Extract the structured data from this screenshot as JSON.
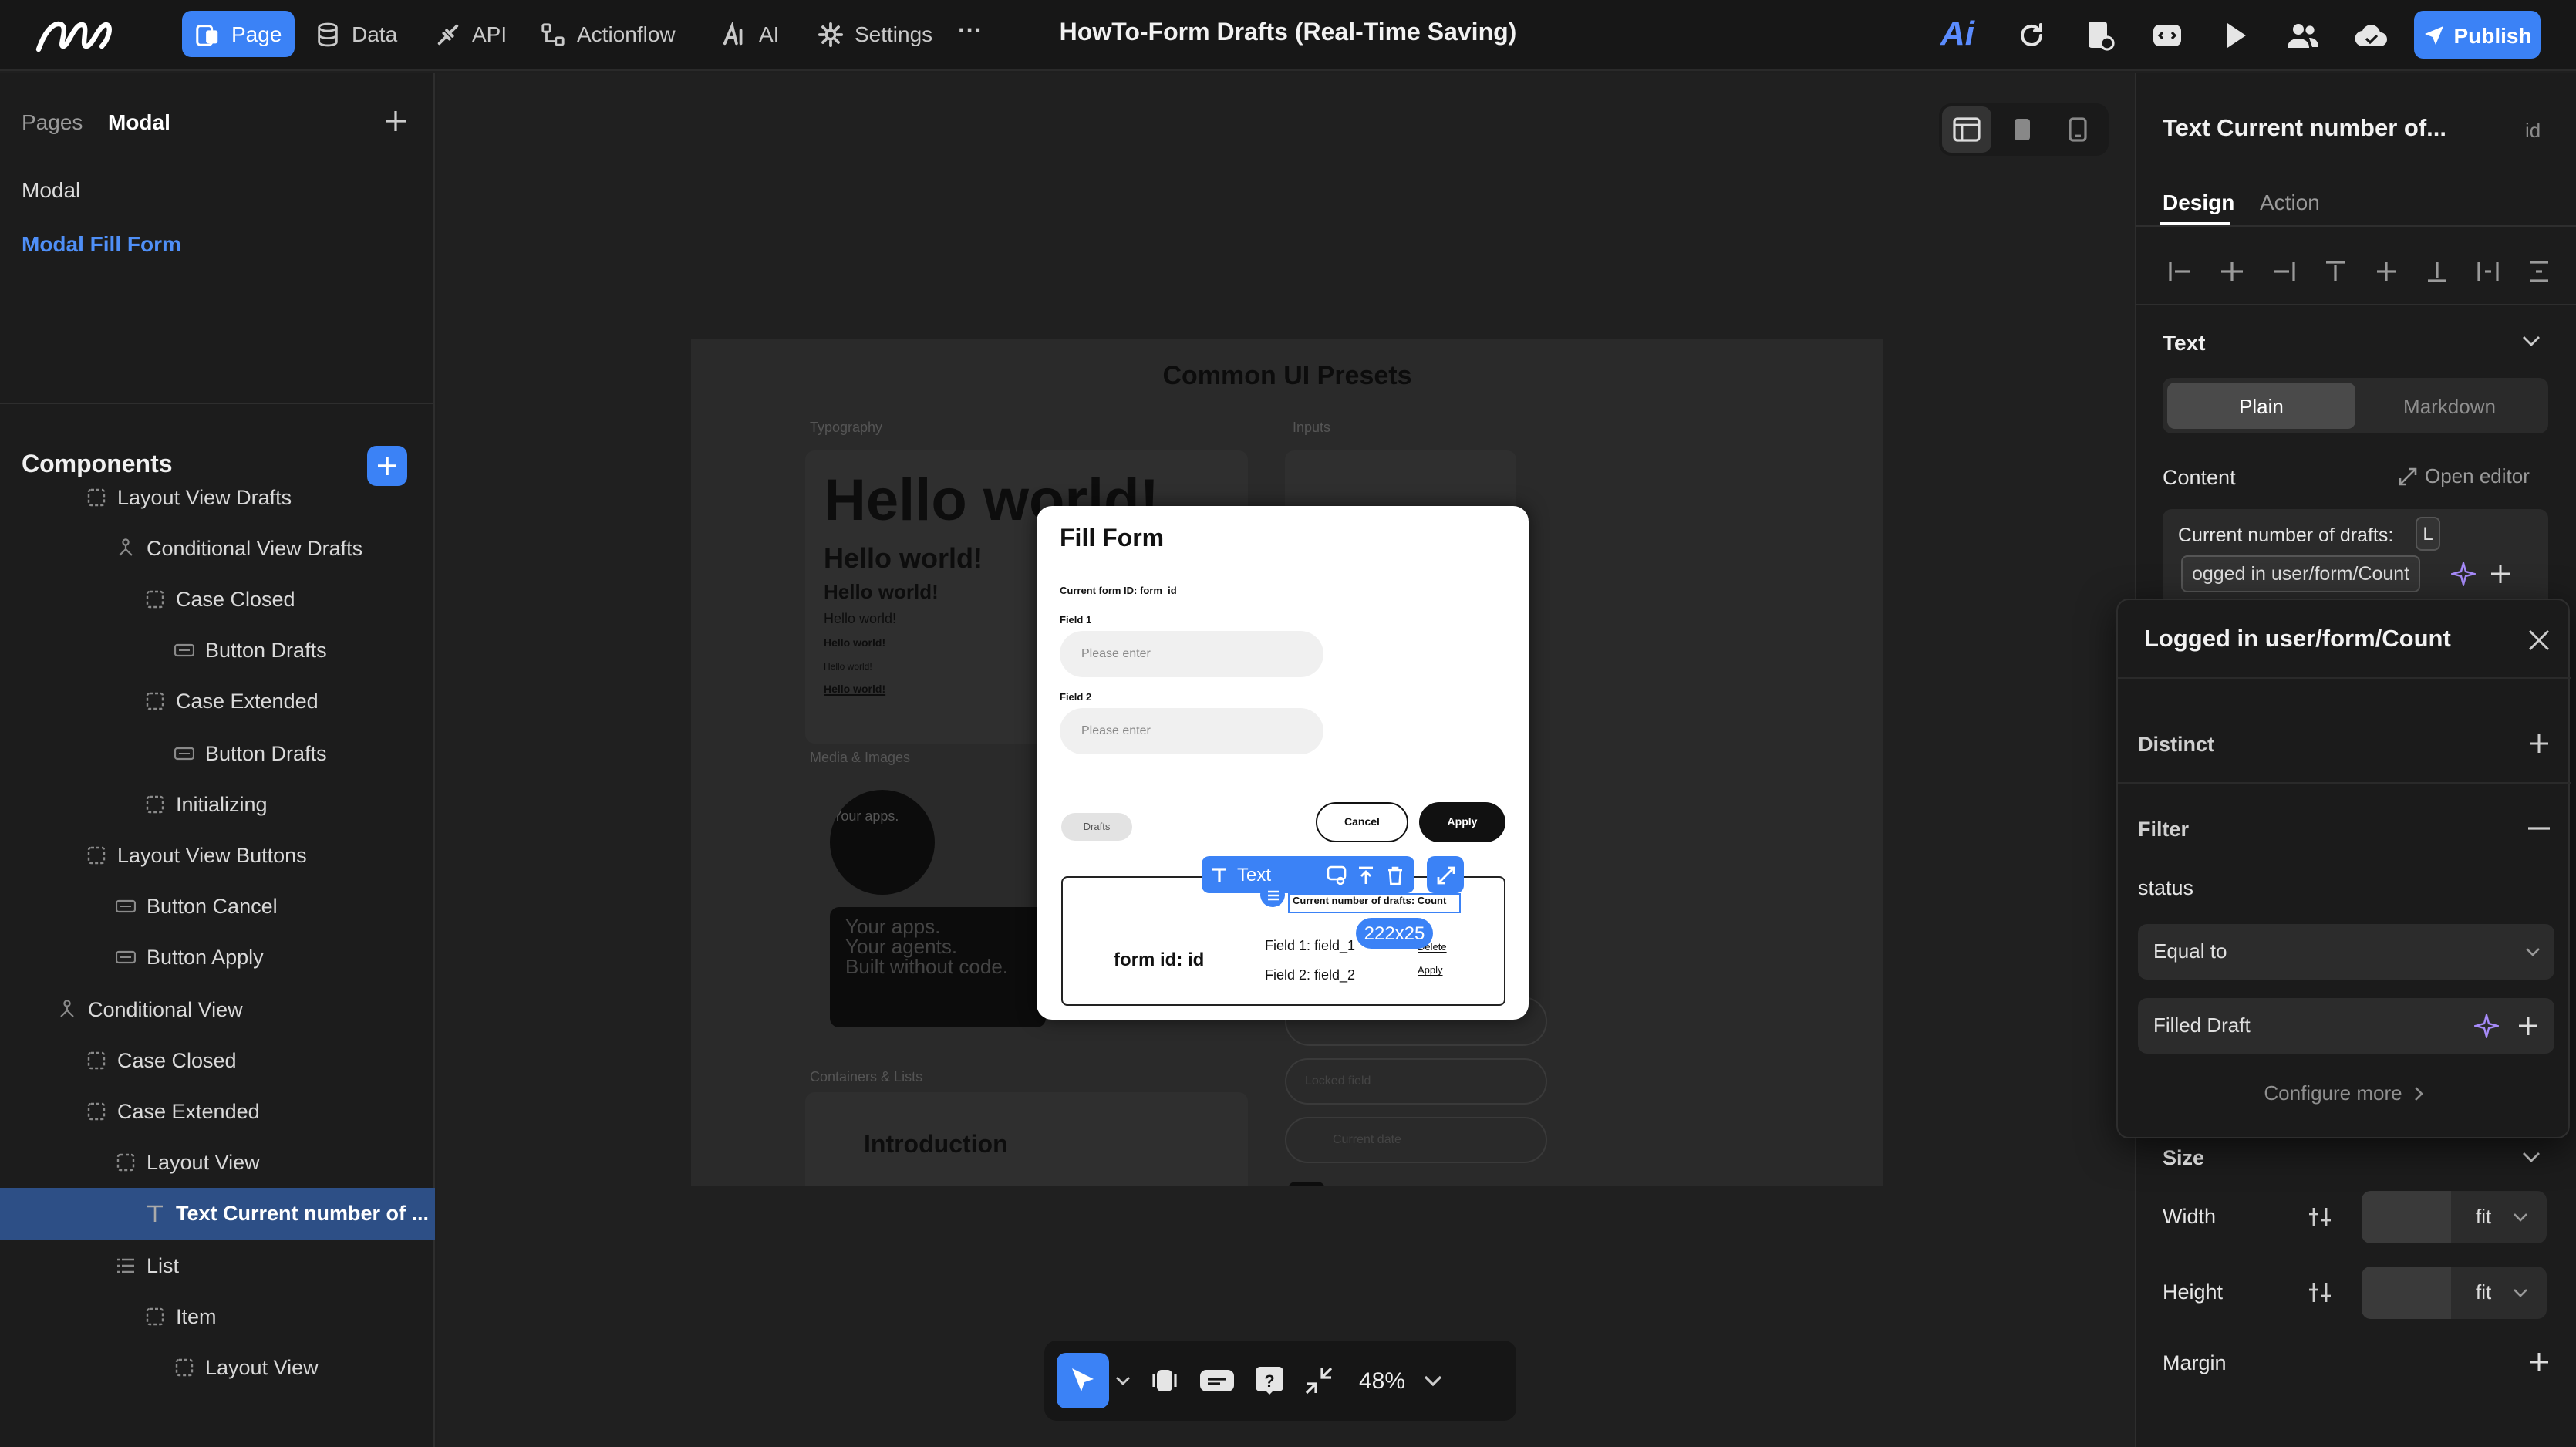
{
  "topbar": {
    "nav": [
      {
        "label": "Page",
        "icon": "page-icon"
      },
      {
        "label": "Data",
        "icon": "database-icon"
      },
      {
        "label": "API",
        "icon": "api-icon"
      },
      {
        "label": "Actionflow",
        "icon": "flow-icon"
      },
      {
        "label": "AI",
        "icon": "ai-icon"
      },
      {
        "label": "Settings",
        "icon": "gear-icon"
      }
    ],
    "more": "···",
    "project_title": "HowTo-Form Drafts (Real-Time Saving)",
    "publish": "Publish",
    "brand_ai": "Ai"
  },
  "left": {
    "tabs": [
      "Pages",
      "Modal"
    ],
    "pages": [
      "Modal",
      "Modal Fill Form"
    ],
    "components_title": "Components",
    "tree": [
      {
        "label": "Layout View Drafts",
        "icon": "layout-icon",
        "indent": 2
      },
      {
        "label": "Conditional View Drafts",
        "icon": "conditional-icon",
        "indent": 3
      },
      {
        "label": "Case Closed",
        "icon": "layout-icon",
        "indent": 4
      },
      {
        "label": "Button Drafts",
        "icon": "button-icon",
        "indent": 5
      },
      {
        "label": "Case Extended",
        "icon": "layout-icon",
        "indent": 4
      },
      {
        "label": "Button Drafts",
        "icon": "button-icon",
        "indent": 5
      },
      {
        "label": "Initializing",
        "icon": "layout-icon",
        "indent": 4
      },
      {
        "label": "Layout View Buttons",
        "icon": "layout-icon",
        "indent": 2
      },
      {
        "label": "Button Cancel",
        "icon": "button-icon",
        "indent": 3
      },
      {
        "label": "Button Apply",
        "icon": "button-icon",
        "indent": 3
      },
      {
        "label": "Conditional View",
        "icon": "conditional-icon",
        "indent": 1
      },
      {
        "label": "Case Closed",
        "icon": "layout-icon",
        "indent": 2
      },
      {
        "label": "Case Extended",
        "icon": "layout-icon",
        "indent": 2
      },
      {
        "label": "Layout View",
        "icon": "layout-icon",
        "indent": 3
      },
      {
        "label": "Text Current number of ...",
        "icon": "text-icon",
        "indent": 4,
        "selected": true
      },
      {
        "label": "List",
        "icon": "list-icon",
        "indent": 3
      },
      {
        "label": "Item",
        "icon": "layout-icon",
        "indent": 4
      },
      {
        "label": "Layout View",
        "icon": "layout-icon",
        "indent": 5
      }
    ]
  },
  "canvas": {
    "zoom": "48%",
    "presets_title": "Common UI Presets",
    "sections": [
      "Typography",
      "Inputs",
      "Media & Images",
      "Containers & Lists"
    ],
    "hello": [
      "Hello world!",
      "Hello world!",
      "Hello world!",
      "Hello world!",
      "Hello world!",
      "Hello world!",
      "Hello world!"
    ],
    "media_text": [
      "Your apps.",
      "Your agents.",
      "Built without code."
    ],
    "intro": "Introduction",
    "bg_inputs": [
      "Locked field",
      "Current date"
    ],
    "modal": {
      "title": "Fill Form",
      "form_id": "Current form ID: form_id",
      "field1_label": "Field 1",
      "field1_placeholder": "Please enter",
      "field2_label": "Field 2",
      "field2_placeholder": "Please enter",
      "drafts": "Drafts",
      "cancel": "Cancel",
      "apply": "Apply",
      "card_id": "form id: id",
      "card_field1": "Field 1: field_1",
      "card_field2": "Field 2: field_2",
      "card_delete": "Delete",
      "card_apply": "Apply",
      "selected_text": "Current number of drafts: Count"
    },
    "toolbar": {
      "label": "Text"
    },
    "size_badge": "222x25"
  },
  "right": {
    "title": "Text Current number of...",
    "id_label": "id",
    "tabs": [
      "Design",
      "Action"
    ],
    "text_section": "Text",
    "modes": [
      "Plain",
      "Markdown"
    ],
    "content_label": "Content",
    "open_editor": "Open editor",
    "content_text": "Current number of drafts:",
    "chip_l": "L",
    "chip_var": "ogged in user/form/Count",
    "popup": {
      "title": "Logged in user/form/Count",
      "distinct": "Distinct",
      "filter": "Filter",
      "field": "status",
      "operator": "Equal to",
      "value": "Filled Draft",
      "configure": "Configure more"
    },
    "size_section": "Size",
    "width_label": "Width",
    "width_value": "fit",
    "height_label": "Height",
    "height_value": "fit",
    "margin_label": "Margin"
  }
}
